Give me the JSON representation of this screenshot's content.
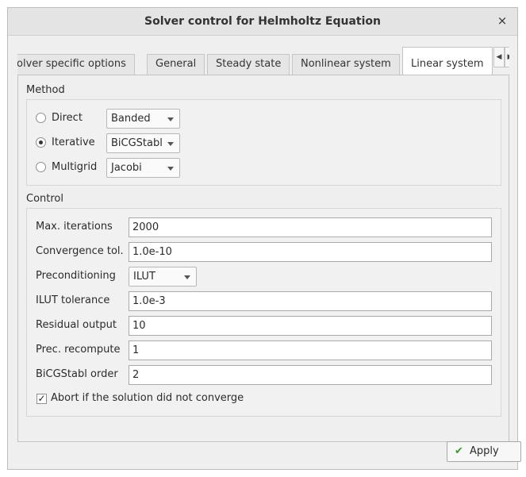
{
  "window": {
    "title": "Solver control for Helmholtz Equation",
    "close_glyph": "×"
  },
  "tabs": [
    {
      "label": "olver specific options"
    },
    {
      "label": "General"
    },
    {
      "label": "Steady state"
    },
    {
      "label": "Nonlinear system"
    },
    {
      "label": "Linear system",
      "active": true
    }
  ],
  "tab_scroll": {
    "left": "◀",
    "right": "▶"
  },
  "method": {
    "group_label": "Method",
    "options": [
      {
        "label": "Direct",
        "checked": false,
        "combo": "Banded"
      },
      {
        "label": "Iterative",
        "checked": true,
        "combo": "BiCGStabl"
      },
      {
        "label": "Multigrid",
        "checked": false,
        "combo": "Jacobi"
      }
    ]
  },
  "control": {
    "group_label": "Control",
    "rows": [
      {
        "label": "Max. iterations",
        "value": "2000"
      },
      {
        "label": "Convergence tol.",
        "value": "1.0e-10"
      },
      {
        "label": "Preconditioning",
        "value": "ILUT"
      },
      {
        "label": "ILUT tolerance",
        "value": "1.0e-3"
      },
      {
        "label": "Residual output",
        "value": "10"
      },
      {
        "label": "Prec. recompute",
        "value": "1"
      },
      {
        "label": "BiCGStabl order",
        "value": "2"
      }
    ],
    "abort_checkbox": {
      "label": "Abort if the solution did not converge",
      "checked": true,
      "glyph": "✓"
    }
  },
  "footer": {
    "apply_label": "Apply",
    "apply_icon": "✔"
  },
  "colors": {
    "apply_icon": "#3c9a2d"
  }
}
